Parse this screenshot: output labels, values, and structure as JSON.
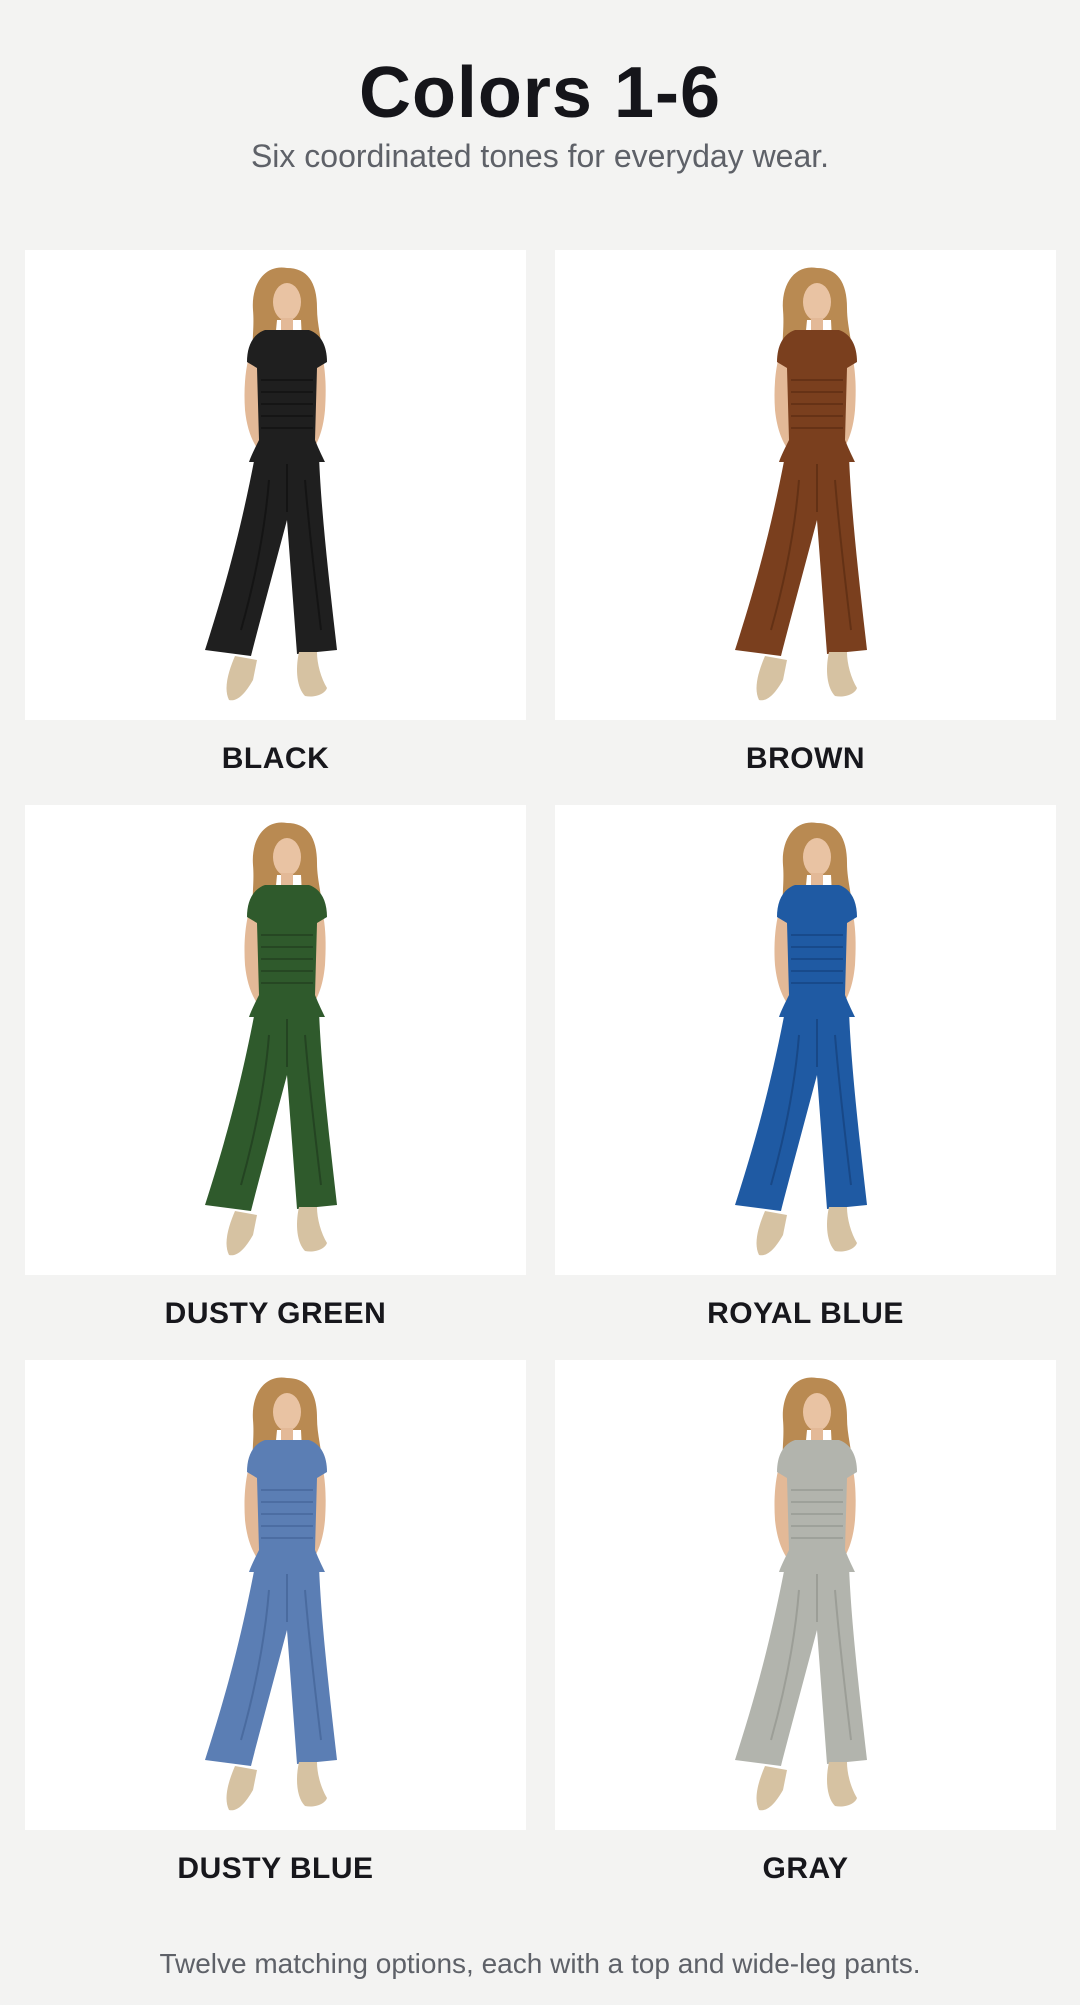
{
  "header": {
    "title": "Colors 1-6",
    "subtitle": "Six coordinated tones for everyday wear."
  },
  "swatches": [
    {
      "label": "BLACK",
      "color": "#1f1f1f",
      "shade": "#111111"
    },
    {
      "label": "BROWN",
      "color": "#7a3f1e",
      "shade": "#5e2e13"
    },
    {
      "label": "DUSTY GREEN",
      "color": "#2f5a2c",
      "shade": "#223f20"
    },
    {
      "label": "ROYAL BLUE",
      "color": "#1f5aa3",
      "shade": "#164380"
    },
    {
      "label": "DUSTY BLUE",
      "color": "#5b7eb4",
      "shade": "#46679a"
    },
    {
      "label": "GRAY",
      "color": "#b2b4ad",
      "shade": "#969891"
    }
  ],
  "footer": {
    "note": "Twelve matching options, each with a top and wide-leg pants."
  }
}
